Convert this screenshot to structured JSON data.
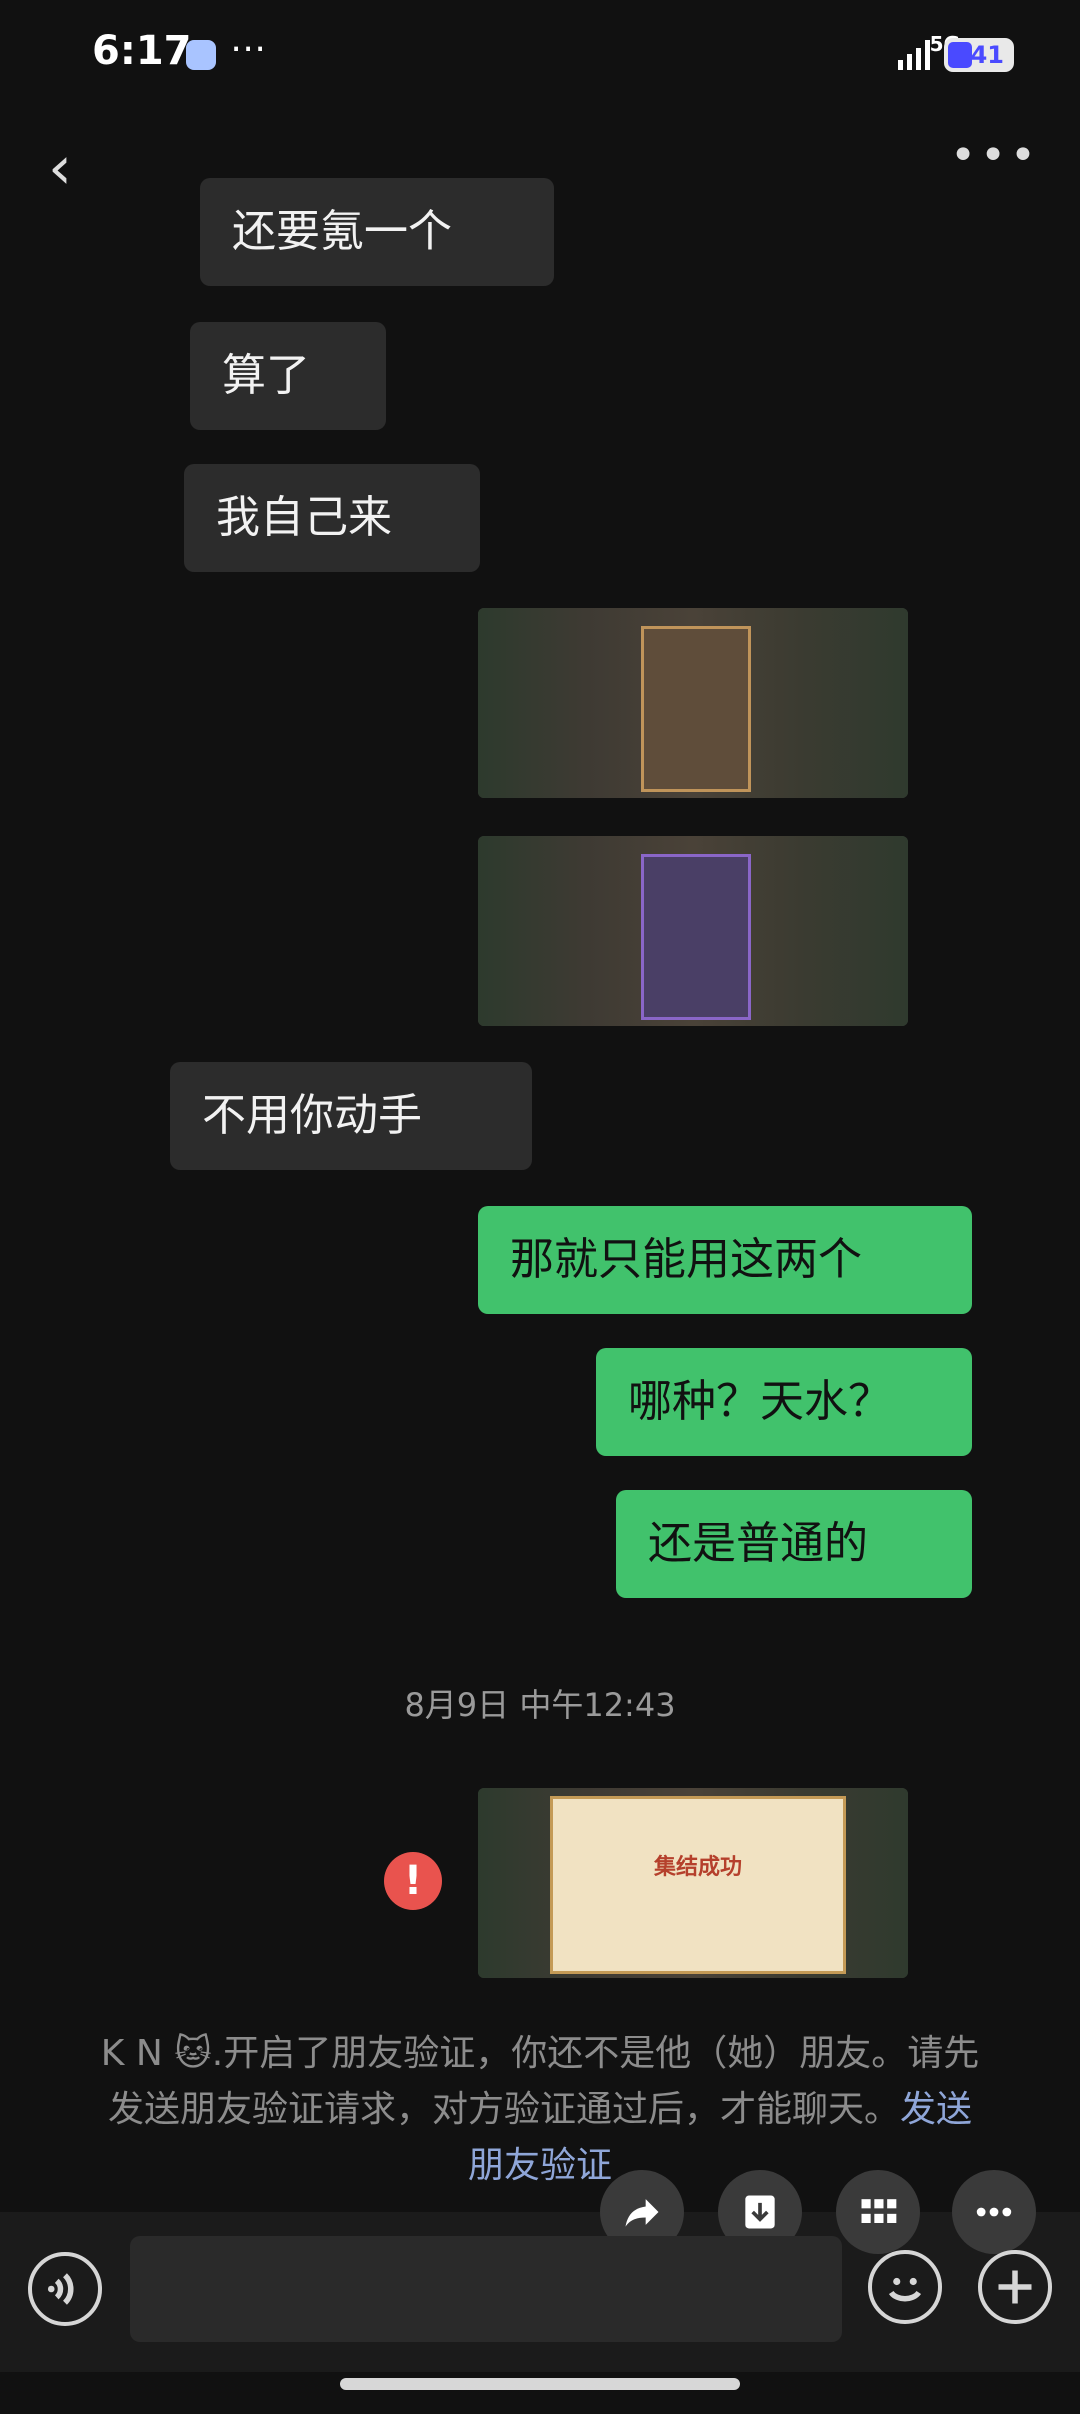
{
  "status_bar": {
    "time": "6:17",
    "network": "5G",
    "battery": "41"
  },
  "messages": [
    {
      "side": "in",
      "text": "还要氪一个"
    },
    {
      "side": "in",
      "text": "算了"
    },
    {
      "side": "in",
      "text": "我自己来"
    },
    {
      "side": "out",
      "type": "image"
    },
    {
      "side": "out",
      "type": "image"
    },
    {
      "side": "in",
      "text": "不用你动手"
    },
    {
      "side": "out",
      "text": "那就只能用这两个"
    },
    {
      "side": "out",
      "text": "哪种？天水？"
    },
    {
      "side": "out",
      "text": "还是普通的"
    }
  ],
  "timestamp": "8月9日 中午12:43",
  "failed_image": {
    "card_title": "集结成功"
  },
  "system_notice": {
    "text": "K N 🐱.开启了朋友验证，你还不是他（她）朋友。请先发送朋友验证请求，对方验证通过后，才能聊天。",
    "link": "发送朋友验证"
  },
  "floating_actions": [
    "share-icon",
    "download-icon",
    "grid-icon",
    "more-icon"
  ],
  "accent": "#41c26c",
  "error_color": "#e9534e"
}
